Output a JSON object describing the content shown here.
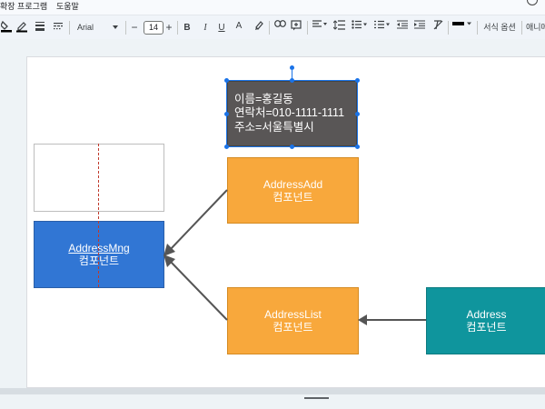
{
  "menu": {
    "items": [
      "확장 프로그램",
      "도움말"
    ]
  },
  "toolbar": {
    "font_name": "Arial",
    "font_size": "14",
    "bold": "B",
    "italic": "I",
    "underline": "U",
    "text_color": "A",
    "format_options": "서식 옵션",
    "animate": "애니메"
  },
  "diagram": {
    "person_box": {
      "lines": [
        "이름=홍길동",
        "연락처=010-1111-1111",
        "주소=서울특별시"
      ]
    },
    "address_mng": {
      "title": "AddressMng",
      "subtitle": "컴포넌트"
    },
    "address_add": {
      "title": "AddressAdd",
      "subtitle": "컴포넌트"
    },
    "address_list": {
      "title": "AddressList",
      "subtitle": "컴포넌트"
    },
    "address": {
      "title": "Address",
      "subtitle": "컴포넌트"
    }
  },
  "colors": {
    "person_box": "#595656",
    "mng": "#3176d4",
    "component_orange": "#f8a83c",
    "address_teal": "#0f959d",
    "arrow": "#555555",
    "selection": "#1a73e8"
  },
  "icons": [
    "paint-bucket-icon",
    "pen-icon",
    "line-weight-icon",
    "line-dash-icon",
    "minus-icon",
    "plus-icon",
    "highlighter-icon",
    "link-icon",
    "comment-add-icon",
    "align-icon",
    "line-spacing-icon",
    "bullet-list-icon",
    "numbered-list-icon",
    "indent-decrease-icon",
    "indent-increase-icon",
    "clear-format-icon",
    "border-icon"
  ]
}
